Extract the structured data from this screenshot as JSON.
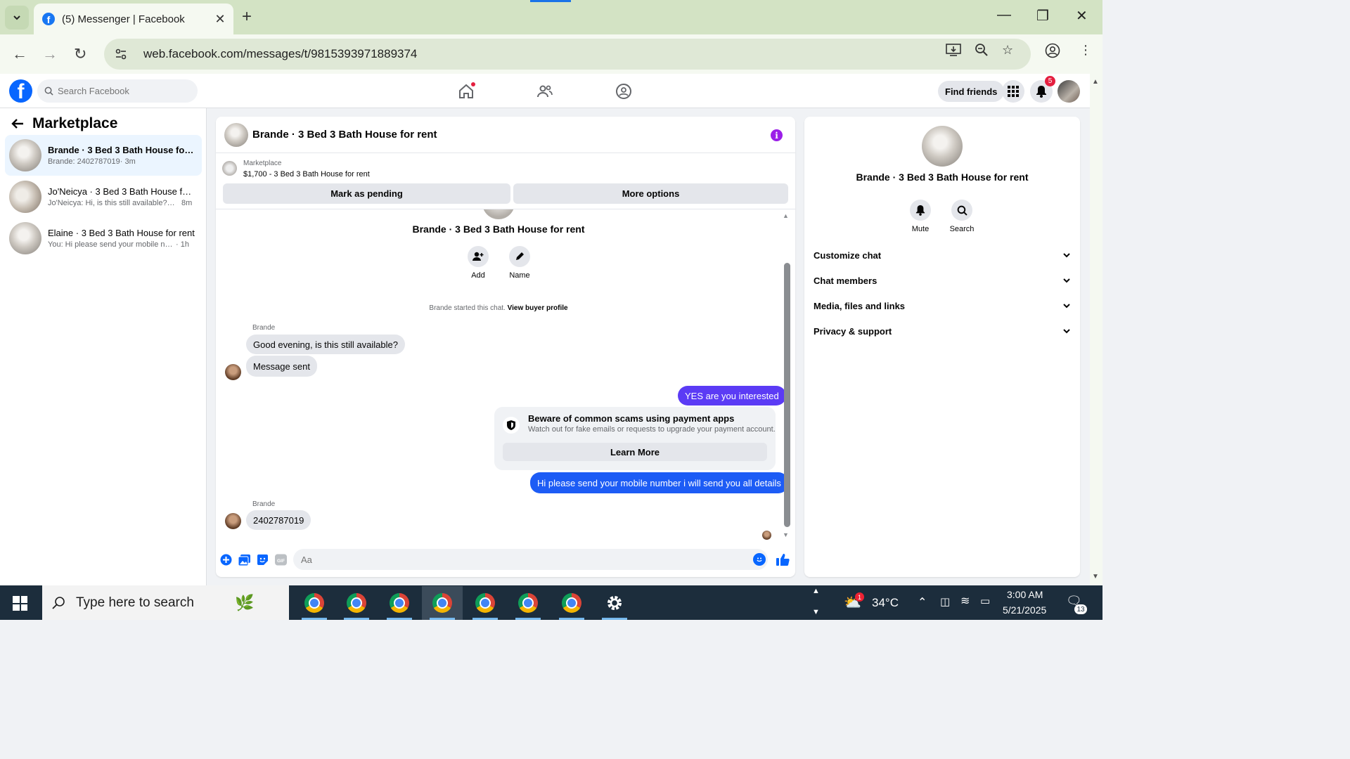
{
  "browser": {
    "tab_title": "(5) Messenger | Facebook",
    "url": "web.facebook.com/messages/t/9815393971889374",
    "tab_close": "✕",
    "new_tab": "+"
  },
  "fb": {
    "search_placeholder": "Search Facebook",
    "find_friends": "Find friends",
    "notification_count": "5",
    "logo_letter": "f"
  },
  "sidebar": {
    "title": "Marketplace",
    "conversations": [
      {
        "name": "Brande · 3 Bed 3 Bath House for re...",
        "preview": "Brande: 2402787019",
        "time": " · 3m",
        "active": true
      },
      {
        "name": "Jo'Neicya · 3 Bed 3 Bath House for...",
        "preview": "Jo'Neicya: Hi, is this still available? W...",
        "time": "8m",
        "active": false
      },
      {
        "name": "Elaine · 3 Bed 3 Bath House for rent",
        "preview": "You: Hi please send your mobile num...",
        "time": " · 1h",
        "active": false
      }
    ]
  },
  "chat": {
    "title": "Brande · 3 Bed 3 Bath House for rent",
    "listing_source": "Marketplace",
    "listing_desc": "$1,700 - 3 Bed 3 Bath House for rent",
    "mark_pending": "Mark as pending",
    "more_options": "More options",
    "intro_name": "Brande · 3 Bed 3 Bath House for rent",
    "intro_add": "Add",
    "intro_name_label": "Name",
    "started_text": "Brande started this chat.",
    "buyer_profile": "View buyer profile",
    "sender_1": "Brande",
    "msg_1": "Good evening, is this still available?",
    "msg_2": "Message sent",
    "msg_out_1": "YES are you interested",
    "scam_title": "Beware of common scams using payment apps",
    "scam_sub": "Watch out for fake emails or requests to upgrade your payment account.",
    "learn_more": "Learn More",
    "msg_out_2": "Hi please send your mobile number  i will send you all details",
    "sender_2": "Brande",
    "msg_3": "2402787019",
    "composer_placeholder": "Aa"
  },
  "info_panel": {
    "name": "Brande · 3 Bed 3 Bath House for rent",
    "mute": "Mute",
    "search": "Search",
    "rows": [
      "Customize chat",
      "Chat members",
      "Media, files and links",
      "Privacy & support"
    ]
  },
  "taskbar": {
    "search_placeholder": "Type here to search",
    "weather": "34°C",
    "weather_badge": "1",
    "time": "3:00 AM",
    "date": "5/21/2025",
    "notif_count": "13"
  },
  "colors": {
    "fb_blue": "#0866ff",
    "outgoing_bubble": "#5b3bf5",
    "info_purple": "#9b1ee8",
    "chrome_tabbar": "#d3e3c4"
  }
}
